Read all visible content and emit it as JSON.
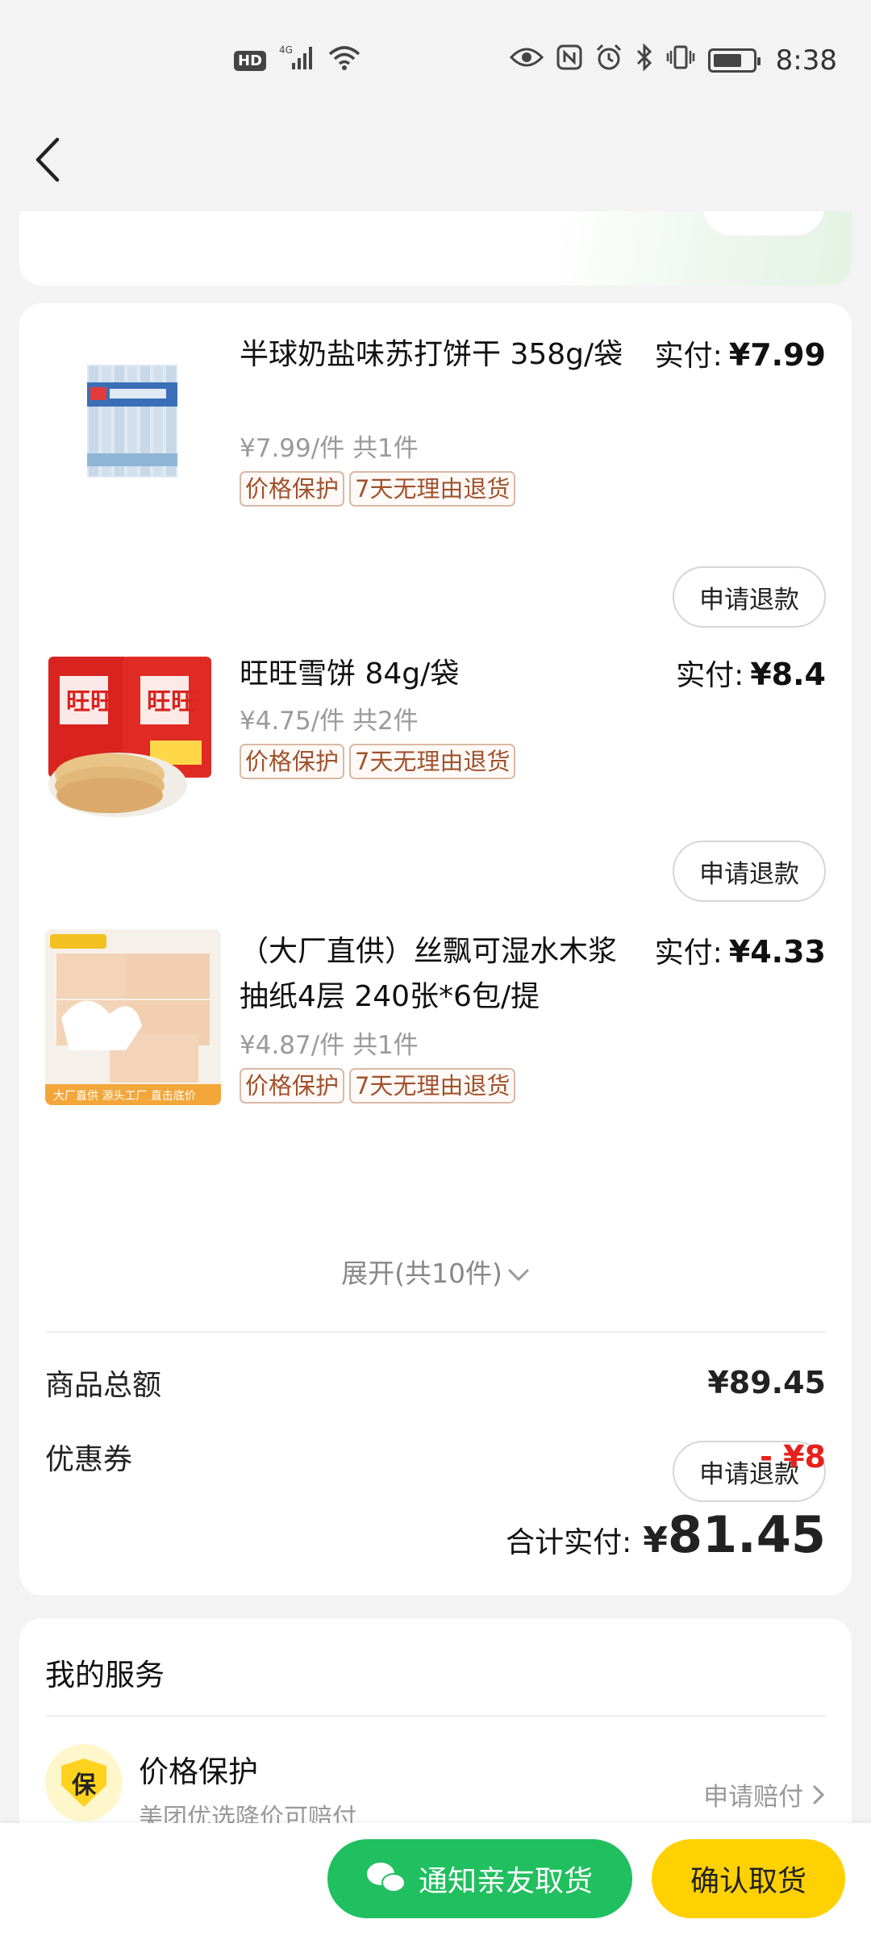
{
  "status_bar": {
    "hd": "HD",
    "signal": "4G",
    "time": "8:38",
    "icons": [
      "eye-icon",
      "nfc-icon",
      "alarm-icon",
      "bluetooth-icon",
      "vibrate-icon",
      "battery-icon"
    ]
  },
  "nav": {
    "back_icon": "chevron-left-icon"
  },
  "items": [
    {
      "title": "半球奶盐味苏打饼干 358g/袋",
      "unit_price": "¥7.99/件",
      "qty": "共1件",
      "tags": [
        "价格保护",
        "7天无理由退货"
      ],
      "paid_label": "实付:",
      "paid_amount": "¥7.99",
      "refund_label": "申请退款"
    },
    {
      "title": "旺旺雪饼 84g/袋",
      "unit_price": "¥4.75/件",
      "qty": "共2件",
      "tags": [
        "价格保护",
        "7天无理由退货"
      ],
      "paid_label": "实付:",
      "paid_amount": "¥8.4",
      "refund_label": "申请退款"
    },
    {
      "title": "（大厂直供）丝飘可湿水木浆抽纸4层 240张*6包/提",
      "unit_price": "¥4.87/件",
      "qty": "共1件",
      "tags": [
        "价格保护",
        "7天无理由退货"
      ],
      "paid_label": "实付:",
      "paid_amount": "¥4.33",
      "refund_label": "申请退款"
    }
  ],
  "expand_label": "展开(共10件)",
  "summary": {
    "goods_total_label": "商品总额",
    "goods_total_value": "¥89.45",
    "coupon_label": "优惠券",
    "coupon_value": "- ¥8",
    "total_label": "合计实付:",
    "total_currency": "¥",
    "total_value": "81.45"
  },
  "services": {
    "title": "我的服务",
    "item_icon_char": "保",
    "item_name": "价格保护",
    "item_desc": "美团优选降价可赔付",
    "item_link": "申请赔付"
  },
  "bottom": {
    "notify_label": "通知亲友取货",
    "confirm_label": "确认取货"
  },
  "colors": {
    "green": "#20bf5f",
    "yellow": "#ffd100",
    "discount_red": "#e8201b",
    "tag_brown": "#a0522d"
  }
}
